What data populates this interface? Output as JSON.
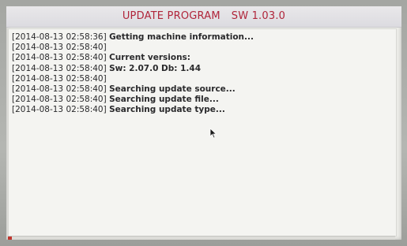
{
  "window": {
    "title": "UPDATE PROGRAM",
    "version": "SW 1.03.0"
  },
  "log": [
    {
      "timestamp": "[2014-08-13 02:58:36]",
      "message": "Getting machine information..."
    },
    {
      "timestamp": "[2014-08-13 02:58:40]",
      "message": ""
    },
    {
      "timestamp": "[2014-08-13 02:58:40]",
      "message": "Current versions:"
    },
    {
      "timestamp": "[2014-08-13 02:58:40]",
      "message": "Sw: 2.07.0  Db: 1.44"
    },
    {
      "timestamp": "[2014-08-13 02:58:40]",
      "message": ""
    },
    {
      "timestamp": "[2014-08-13 02:58:40]",
      "message": "Searching update source..."
    },
    {
      "timestamp": "[2014-08-13 02:58:40]",
      "message": "Searching update file..."
    },
    {
      "timestamp": "[2014-08-13 02:58:40]",
      "message": "Searching update type..."
    }
  ],
  "progress": {
    "fraction": 0.01
  },
  "colors": {
    "title": "#b0253a",
    "progress": "#c0352e"
  },
  "icons": {
    "cursor": "mouse-pointer-icon"
  }
}
